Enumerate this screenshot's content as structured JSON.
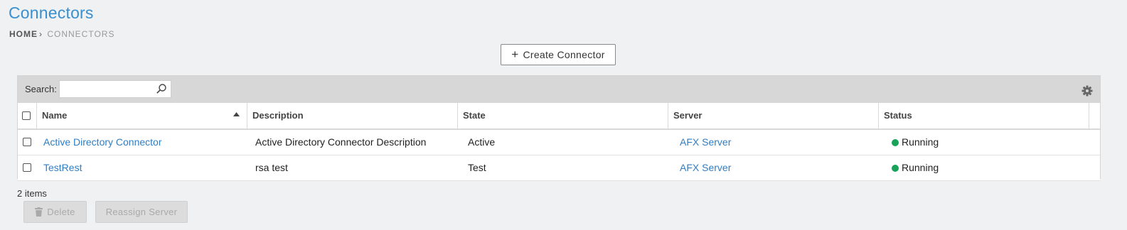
{
  "page": {
    "title": "Connectors",
    "breadcrumb": {
      "home": "HOME",
      "separator": "›",
      "current": "CONNECTORS"
    }
  },
  "toolbar": {
    "create_label": "Create Connector"
  },
  "grid": {
    "search_label": "Search:",
    "search_value": "",
    "search_placeholder": "",
    "columns": [
      "Name",
      "Description",
      "State",
      "Server",
      "Status"
    ],
    "sort": {
      "column": "Name",
      "direction": "ascending"
    },
    "rows": [
      {
        "name": "Active Directory Connector",
        "description": "Active Directory Connector Description",
        "state": "Active",
        "server": "AFX Server",
        "status": "Running"
      },
      {
        "name": "TestRest",
        "description": "rsa test",
        "state": "Test",
        "server": "AFX Server",
        "status": "Running"
      }
    ]
  },
  "footer": {
    "items_count": "2 items",
    "delete_label": "Delete",
    "reassign_label": "Reassign Server"
  },
  "colors": {
    "accent": "#3a8fcf",
    "link": "#2f7ec4",
    "status_running": "#19a35a",
    "toolbar_bg": "#d7d7d7"
  },
  "icons": [
    "plus-icon",
    "search-icon",
    "gear-icon",
    "sort-ascending-icon",
    "trash-icon",
    "status-dot-icon"
  ]
}
